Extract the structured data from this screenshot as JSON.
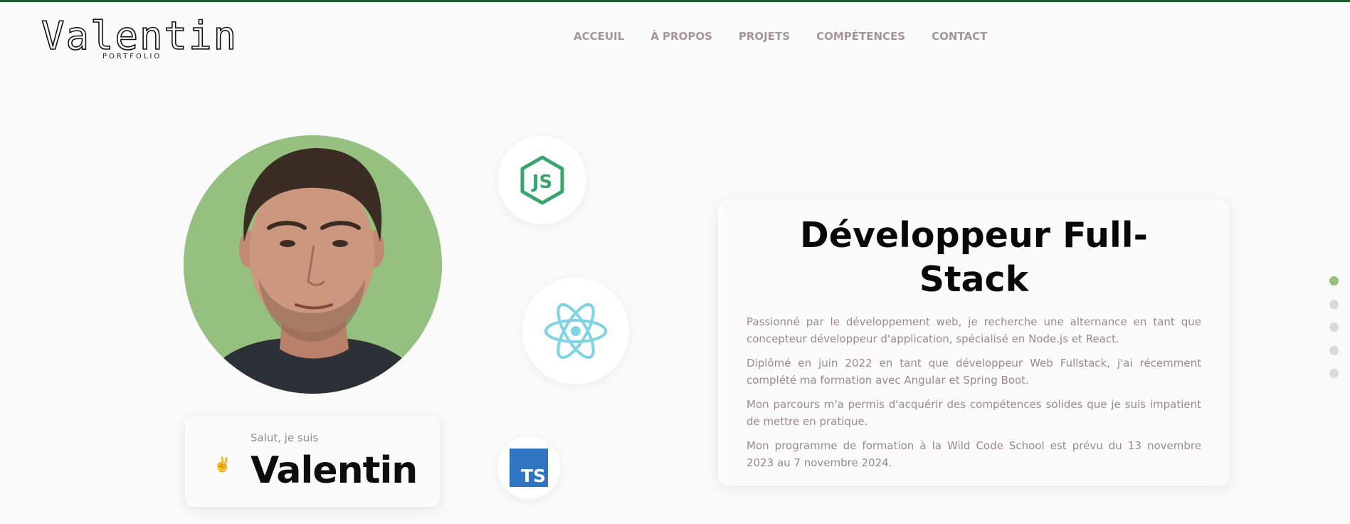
{
  "brand": {
    "name": "Valentin",
    "tagline": "PORTFOLIO"
  },
  "nav": {
    "items": [
      "ACCEUIL",
      "À PROPOS",
      "PROJETS",
      "COMPÉTENCES",
      "CONTACT"
    ]
  },
  "hero": {
    "greeting": "Salut, je suis",
    "wave_emoji": "✌",
    "name": "Valentin",
    "photo_icon": "profile-photo",
    "tech_icons": [
      "nodejs-icon",
      "react-icon",
      "typescript-icon"
    ],
    "ts_label": "TS"
  },
  "about": {
    "title": "Développeur Full-Stack",
    "paragraphs": [
      "Passionné par le développement web, je recherche une alternance en tant que concepteur développeur d'application, spécialisé en Node.js et React.",
      "Diplômé en juin 2022 en tant que développeur Web Fullstack, j'ai récemment complété ma formation avec Angular et Spring Boot.",
      "Mon parcours m'a permis d'acquérir des compétences solides que je suis impatient de mettre en pratique.",
      "Mon programme de formation à la Wild Code School est prévu du 13 novembre 2023 au 7 novembre 2024."
    ]
  },
  "section_nav": {
    "count": 5,
    "active_index": 0
  },
  "colors": {
    "accent_green": "#95c07f",
    "nav_text": "#a7949b",
    "body_text": "#9a888e",
    "node_green": "#3aa46e",
    "react_cyan": "#7fd3e3",
    "ts_blue": "#2f74c0",
    "top_bar": "#1e5a33"
  }
}
